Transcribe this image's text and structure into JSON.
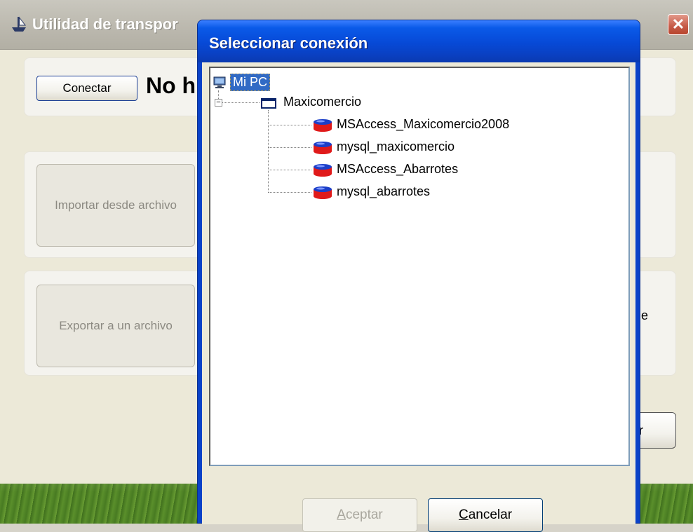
{
  "main_window": {
    "title": "Utilidad de transpor",
    "close_glyph": "✕",
    "app_icon": "ship-icon",
    "connect_button_label": "Conectar",
    "connection_status": "No h",
    "import_button_label": "Importar desde archivo",
    "export_button_label": "Exportar a un archivo",
    "partial_text_right": "e",
    "partial_button_label": "r"
  },
  "dialog": {
    "title": "Seleccionar conexión",
    "tree": {
      "root_label": "Mi PC",
      "root_icon": "computer-icon",
      "expander_glyph": "−",
      "group_label": "Maxicomercio",
      "group_icon": "window-icon",
      "connections": [
        {
          "label": "MSAccess_Maxicomercio2008",
          "icon": "database-icon"
        },
        {
          "label": "mysql_maxicomercio",
          "icon": "database-icon"
        },
        {
          "label": "MSAccess_Abarrotes",
          "icon": "database-icon"
        },
        {
          "label": "mysql_abarrotes",
          "icon": "database-icon"
        }
      ]
    },
    "accept_label": "Aceptar",
    "cancel_label": "Cancelar"
  },
  "colors": {
    "title_bar_blue": "#0a5ae8",
    "selection_blue": "#316ac5",
    "database_red": "#e01a1a",
    "database_blue": "#1c3fc8"
  }
}
